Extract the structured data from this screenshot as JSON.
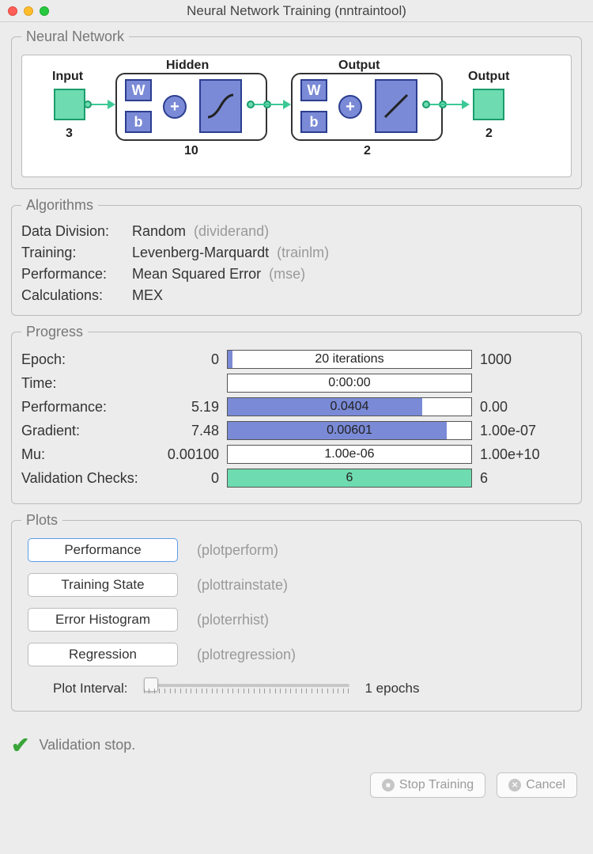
{
  "window": {
    "title": "Neural Network Training (nntraintool)"
  },
  "network": {
    "legend": "Neural Network",
    "input_label": "Input",
    "input_size": "3",
    "hidden_label": "Hidden",
    "hidden_size": "10",
    "output_layer_label": "Output",
    "output_layer_size": "2",
    "output_label": "Output",
    "output_size": "2",
    "w": "W",
    "b": "b",
    "plus": "+"
  },
  "algorithms": {
    "legend": "Algorithms",
    "rows": [
      {
        "label": "Data Division:",
        "value": "Random",
        "fn": "(dividerand)"
      },
      {
        "label": "Training:",
        "value": "Levenberg-Marquardt",
        "fn": "(trainlm)"
      },
      {
        "label": "Performance:",
        "value": "Mean Squared Error",
        "fn": "(mse)"
      },
      {
        "label": "Calculations:",
        "value": "MEX",
        "fn": ""
      }
    ]
  },
  "progress": {
    "legend": "Progress",
    "rows": [
      {
        "label": "Epoch:",
        "start": "0",
        "value": "20 iterations",
        "end": "1000",
        "fill": 2,
        "color": "blue"
      },
      {
        "label": "Time:",
        "start": "",
        "value": "0:00:00",
        "end": "",
        "fill": 0,
        "color": "blue"
      },
      {
        "label": "Performance:",
        "start": "5.19",
        "value": "0.0404",
        "end": "0.00",
        "fill": 80,
        "color": "blue"
      },
      {
        "label": "Gradient:",
        "start": "7.48",
        "value": "0.00601",
        "end": "1.00e-07",
        "fill": 90,
        "color": "blue"
      },
      {
        "label": "Mu:",
        "start": "0.00100",
        "value": "1.00e-06",
        "end": "1.00e+10",
        "fill": 0,
        "color": "blue"
      },
      {
        "label": "Validation Checks:",
        "start": "0",
        "value": "6",
        "end": "6",
        "fill": 100,
        "color": "green"
      }
    ]
  },
  "plots": {
    "legend": "Plots",
    "buttons": [
      {
        "label": "Performance",
        "fn": "(plotperform)",
        "selected": true
      },
      {
        "label": "Training State",
        "fn": "(plottrainstate)",
        "selected": false
      },
      {
        "label": "Error Histogram",
        "fn": "(ploterrhist)",
        "selected": false
      },
      {
        "label": "Regression",
        "fn": "(plotregression)",
        "selected": false
      }
    ],
    "interval_label": "Plot Interval:",
    "interval_value": "1 epochs"
  },
  "status": {
    "text": "Validation stop."
  },
  "buttons": {
    "stop": "Stop Training",
    "cancel": "Cancel"
  }
}
